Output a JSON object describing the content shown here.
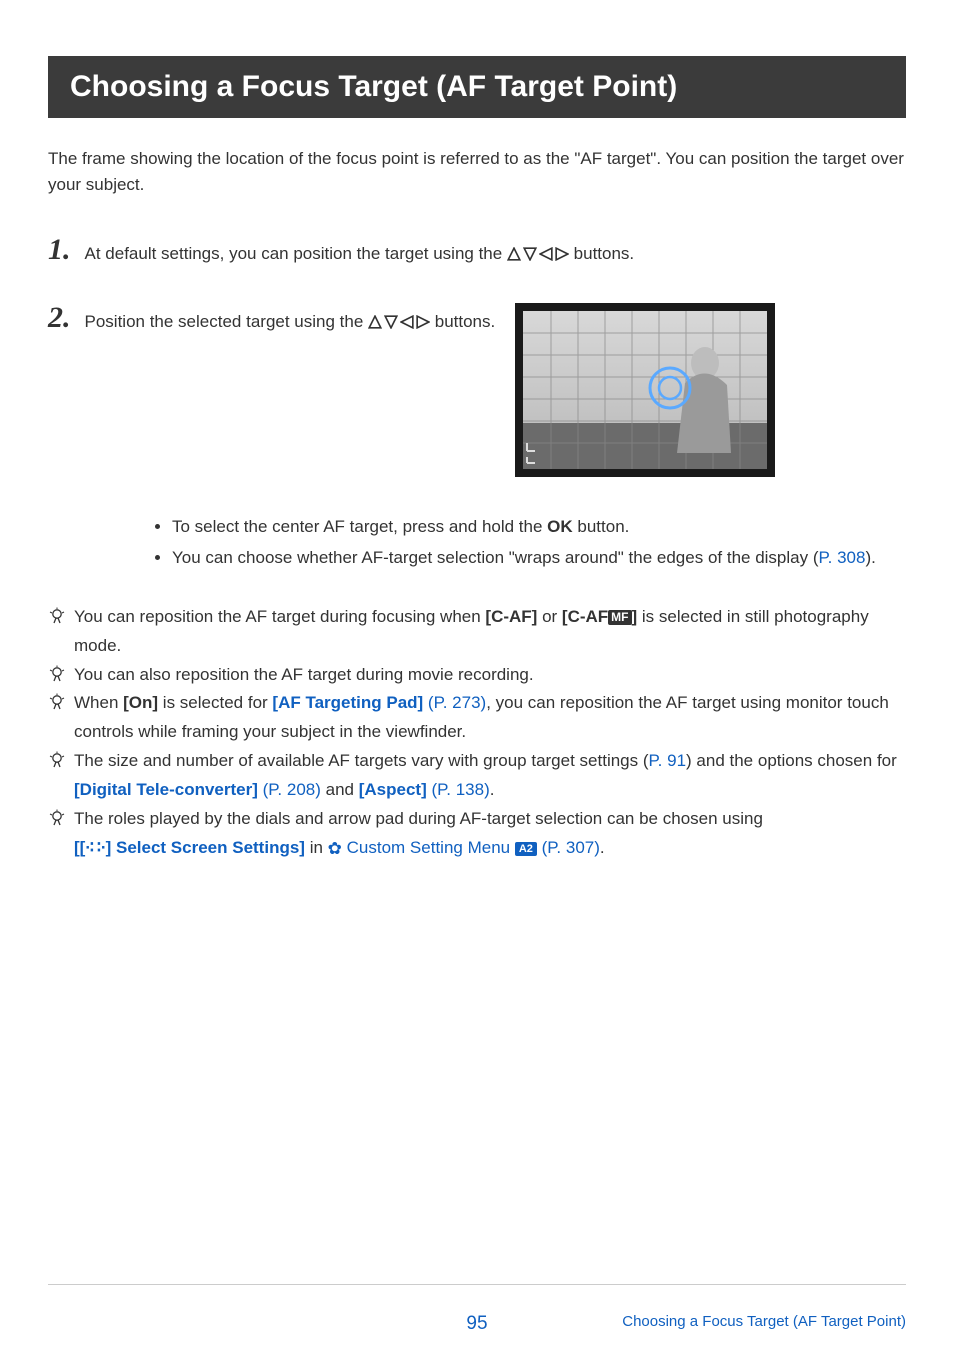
{
  "title": "Choosing a Focus Target (AF Target Point)",
  "intro": "The frame showing the location of the focus point is referred to as the \"AF target\". You can position the target over your subject.",
  "steps": {
    "s1": {
      "num": "1",
      "before": "At default settings, you can position the target using the ",
      "after": " buttons."
    },
    "s2": {
      "num": "2",
      "before": "Position the selected target using the ",
      "after": " buttons."
    }
  },
  "subbullets": {
    "b1_before": "To select the center AF target, press and hold the ",
    "b1_bold": "OK",
    "b1_after": " button.",
    "b2_before": "You can choose whether AF-target selection \"wraps around\" the edges of the display (",
    "b2_link": "P. 308",
    "b2_after": ")."
  },
  "hints": {
    "h1": {
      "before": "You can reposition the AF target during focusing when ",
      "bold1": "[C-AF]",
      "mid": " or ",
      "bold2a": "[C-AF",
      "mf": "MF",
      "bold2b": "]",
      "after": " is selected in still photography mode."
    },
    "h2": "You can also reposition the AF target during movie recording.",
    "h3": {
      "before": "When ",
      "bold1": "[On]",
      "mid1": " is selected for ",
      "link1": "[AF Targeting Pad]",
      "link1p": " (P. 273)",
      "after": ", you can reposition the AF target using monitor touch controls while framing your subject in the viewfinder."
    },
    "h4": {
      "before": "The size and number of available AF targets vary with group target settings (",
      "link1": "P. 91",
      "mid": ") and the options chosen for ",
      "link2": "[Digital Tele-converter]",
      "link2p": " (P. 208)",
      "mid2": " and ",
      "link3": "[Aspect]",
      "link3p": " (P. 138)",
      "after": "."
    },
    "h5": {
      "line1": "The roles played by the dials and arrow pad during AF-target selection can be chosen using",
      "linkA_open": "[",
      "select_glyph": "[∙∷∙]",
      "linkA_label": " Select Screen Settings]",
      "mid": " in ",
      "gear": "✿",
      "menu_label": " Custom Setting Menu ",
      "a2": "A2",
      "page": " (P. 307)",
      "dot": "."
    }
  },
  "footer": {
    "page": "95",
    "crumb": "Choosing a Focus Target (AF Target Point)"
  }
}
